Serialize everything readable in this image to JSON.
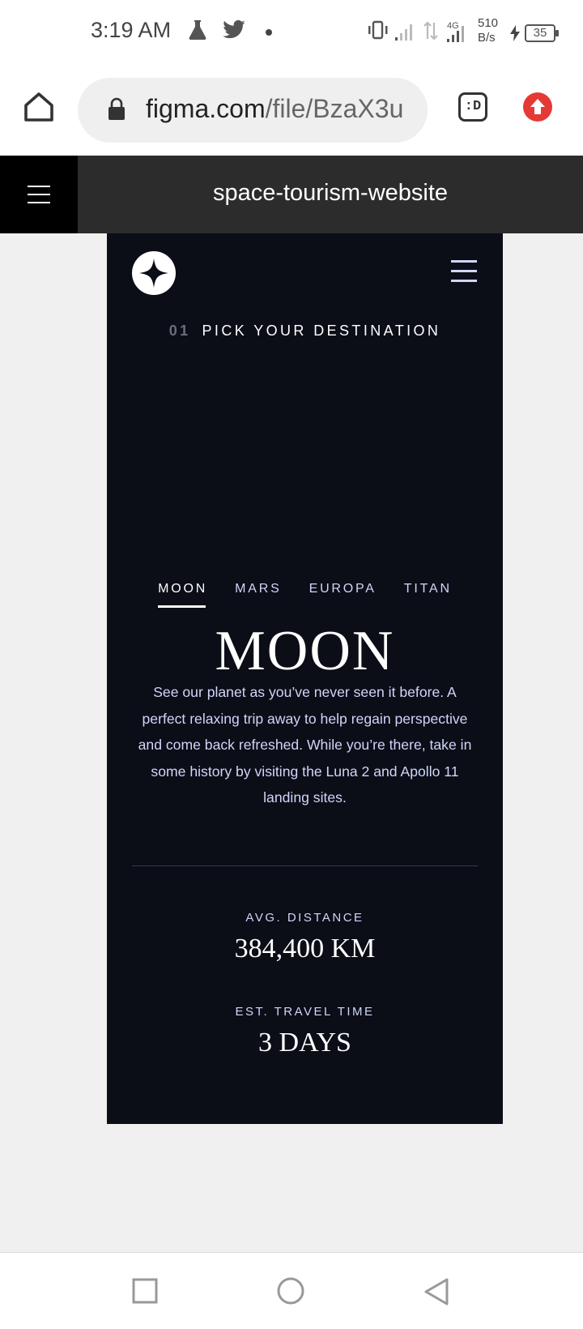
{
  "status_bar": {
    "time": "3:19 AM",
    "icons": [
      "flask-icon",
      "twitter-icon",
      "dot-icon",
      "vibrate-icon",
      "signal-icon",
      "data-arrows-icon",
      "signal-4g-icon",
      "charging-icon"
    ],
    "network_type": "4G",
    "net_speed_value": "510",
    "net_speed_unit": "B/s",
    "battery_level": "35"
  },
  "browser": {
    "url_domain": "figma.com",
    "url_path": "/file/BzaX3u",
    "tabs_label": ":D"
  },
  "figma": {
    "file_title": "space-tourism-website"
  },
  "page": {
    "eyebrow_number": "01",
    "eyebrow_text": "PICK YOUR DESTINATION",
    "tabs": [
      {
        "label": "MOON",
        "active": true
      },
      {
        "label": "MARS",
        "active": false
      },
      {
        "label": "EUROPA",
        "active": false
      },
      {
        "label": "TITAN",
        "active": false
      }
    ],
    "destination_name": "MOON",
    "description": "See our planet as you’ve never seen it before. A perfect relaxing trip away to help regain perspective and come back refreshed. While you’re there, take in some history by visiting the Luna 2 and Apollo 11 landing sites.",
    "stats": [
      {
        "label": "AVG. DISTANCE",
        "value": "384,400 KM"
      },
      {
        "label": "EST. TRAVEL TIME",
        "value": "3 DAYS"
      }
    ]
  },
  "colors": {
    "frame_bg": "#0b0d17",
    "accent_text": "#d0d6f9",
    "figma_header": "#2c2c2c",
    "update_button": "#e53935"
  }
}
